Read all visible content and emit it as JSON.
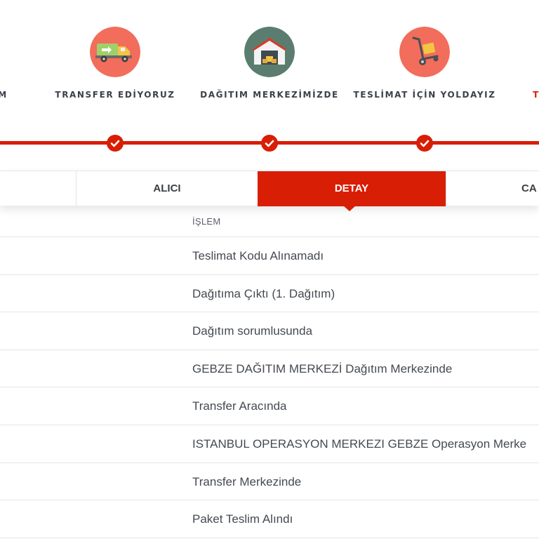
{
  "steps": [
    {
      "label": "M",
      "icon": "partial-step-icon"
    },
    {
      "label": "TRANSFER EDİYORUZ",
      "icon": "truck-icon",
      "icon_bg": "#f26d5b"
    },
    {
      "label": "DAĞITIM MERKEZİMİZDE",
      "icon": "warehouse-icon",
      "icon_bg": "#5b7d70"
    },
    {
      "label": "TESLİMAT İÇİN YOLDAYIZ",
      "icon": "hand-truck-icon",
      "icon_bg": "#f26d5b"
    },
    {
      "label": "T",
      "icon": "partial-step-icon"
    }
  ],
  "accent_color": "#d81e05",
  "tabs": [
    {
      "label": ""
    },
    {
      "label": "ALICI"
    },
    {
      "label": "DETAY"
    },
    {
      "label": "CA"
    }
  ],
  "table": {
    "header": "İŞLEM",
    "rows": [
      "Teslimat Kodu Alınamadı",
      "Dağıtıma Çıktı (1. Dağıtım)",
      "Dağıtım sorumlusunda",
      "GEBZE DAĞITIM MERKEZİ Dağıtım Merkezinde",
      "Transfer Aracında",
      "ISTANBUL OPERASYON MERKEZI GEBZE Operasyon Merke",
      "Transfer Merkezinde",
      "Paket Teslim Alındı"
    ]
  }
}
